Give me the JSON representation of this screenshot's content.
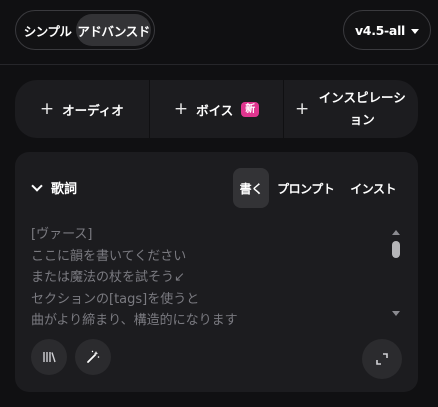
{
  "mode_toggle": {
    "simple": "シンプル",
    "advanced": "アドバンスド",
    "selected": "advanced"
  },
  "version_select": {
    "value": "v4.5-all"
  },
  "add_bar": {
    "audio": {
      "plus": "+",
      "label": "オーディオ"
    },
    "voice": {
      "plus": "+",
      "label": "ボイス",
      "badge": "新"
    },
    "inspiration": {
      "plus": "+",
      "label": "インスピレーション"
    }
  },
  "lyrics": {
    "title": "歌詞",
    "tabs": [
      {
        "label": "書く",
        "active": true
      },
      {
        "label": "プロンプト",
        "active": false
      },
      {
        "label": "インスト",
        "active": false
      }
    ],
    "placeholder": "[ヴァース]\nここに韻を書いてください\nまたは魔法の杖を試そう↙\nセクションの[tags]を使うと\n曲がより締まり、構造的になります"
  },
  "icons": {
    "library": "library-icon",
    "magic_wand": "magic-wand-icon",
    "expand": "expand-icon",
    "chevron": "chevron-down-icon",
    "caret": "caret-down-icon"
  },
  "colors": {
    "background": "#101012",
    "panel": "#1c1c1f",
    "active": "#333336",
    "badge": "#e0358f"
  }
}
